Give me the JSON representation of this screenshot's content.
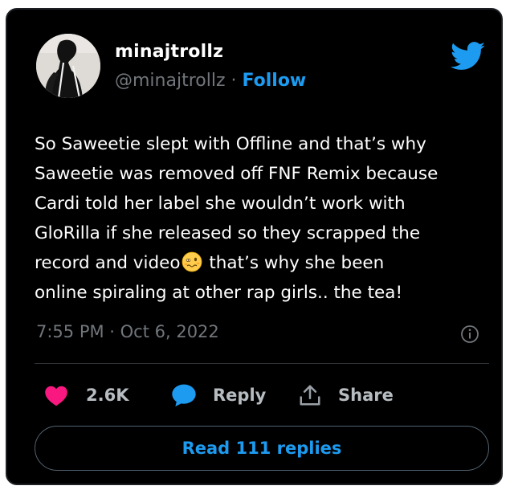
{
  "tweet": {
    "display_name": "minajtrollz",
    "handle": "@minajtrollz",
    "separator": " · ",
    "follow_label": "Follow",
    "text_lines": [
      "So Saweetie slept with Offline and that’s why",
      "Saweetie was removed off FNF Remix because",
      "Cardi told her label she wouldn’t work with",
      "GloRilla if she released so they scrapped the",
      "record and video",
      " that’s why she been",
      "online spiraling at other rap girls.. the tea!"
    ],
    "emoji": "woozy-face-emoji",
    "timestamp": "7:55 PM · Oct 6, 2022"
  },
  "actions": {
    "like_count": "2.6K",
    "reply_label": "Reply",
    "share_label": "Share",
    "read_replies_label": "Read 111 replies"
  },
  "icons": {
    "brand": "twitter-bird-icon",
    "like": "heart-icon",
    "reply": "speech-bubble-icon",
    "share": "share-upload-icon",
    "info": "info-icon"
  },
  "colors": {
    "background": "#000000",
    "accent": "#1d9bf0",
    "like": "#f91880",
    "muted_text": "#71767b",
    "text": "#ffffff"
  }
}
